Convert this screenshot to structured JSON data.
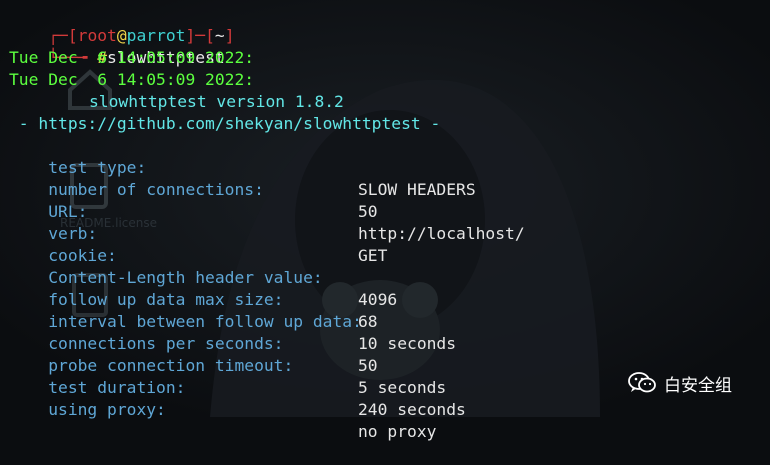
{
  "prompt": {
    "user": "root",
    "at": "@",
    "host": "parrot",
    "dir": "~",
    "command": "slowhttptest"
  },
  "dates": [
    "Tue Dec  6 14:05:09 2022:",
    "Tue Dec  6 14:05:09 2022:"
  ],
  "version_line": "slowhttptest version 1.8.2",
  "github_line": " - https://github.com/shekyan/slowhttptest -",
  "params": [
    {
      "label": "test type:",
      "value": "SLOW HEADERS"
    },
    {
      "label": "number of connections:",
      "value": "50"
    },
    {
      "label": "URL:",
      "value": "http://localhost/"
    },
    {
      "label": "verb:",
      "value": "GET"
    },
    {
      "label": "cookie:",
      "value": ""
    },
    {
      "label": "Content-Length header value:",
      "value": "4096"
    },
    {
      "label": "follow up data max size:",
      "value": "68"
    },
    {
      "label": "interval between follow up data:",
      "value": "10 seconds"
    },
    {
      "label": "connections per seconds:",
      "value": "50"
    },
    {
      "label": "probe connection timeout:",
      "value": "5 seconds"
    },
    {
      "label": "test duration:",
      "value": "240 seconds"
    },
    {
      "label": "using proxy:",
      "value": "no proxy"
    }
  ],
  "background": {
    "desktop_icon_label": "README.license"
  },
  "watermark": {
    "text": "白安全组",
    "icon": "wechat-icon"
  }
}
